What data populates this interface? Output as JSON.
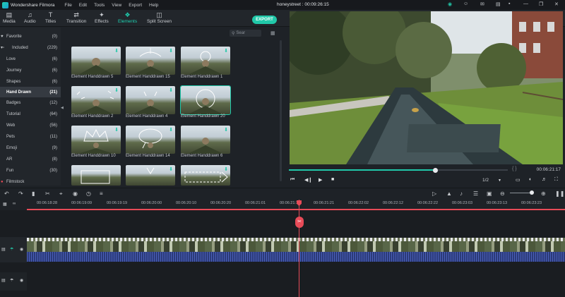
{
  "app": {
    "name": "Wondershare Filmora",
    "project_title": "honeystreet : 00:09:26:15"
  },
  "menu": [
    "File",
    "Edit",
    "Tools",
    "View",
    "Export",
    "Help"
  ],
  "toolbar": {
    "tabs": [
      {
        "label": "Media",
        "icon": "folder-icon"
      },
      {
        "label": "Audio",
        "icon": "music-note-icon"
      },
      {
        "label": "Titles",
        "icon": "text-icon"
      },
      {
        "label": "Transition",
        "icon": "transition-icon"
      },
      {
        "label": "Effects",
        "icon": "effects-icon"
      },
      {
        "label": "Elements",
        "icon": "elements-icon"
      },
      {
        "label": "Split Screen",
        "icon": "split-screen-icon"
      }
    ],
    "active": "Elements",
    "export_label": "EXPORT"
  },
  "sidebar": {
    "items": [
      {
        "label": "Favorite",
        "count": "(0)"
      },
      {
        "label": "Included",
        "count": "(229)"
      },
      {
        "label": "Love",
        "count": "(6)"
      },
      {
        "label": "Journey",
        "count": "(6)"
      },
      {
        "label": "Shapes",
        "count": "(6)"
      },
      {
        "label": "Hand Drawn",
        "count": "(21)"
      },
      {
        "label": "Badges",
        "count": "(12)"
      },
      {
        "label": "Tutorial",
        "count": "(64)"
      },
      {
        "label": "Web",
        "count": "(56)"
      },
      {
        "label": "Pets",
        "count": "(11)"
      },
      {
        "label": "Emoji",
        "count": "(9)"
      },
      {
        "label": "AR",
        "count": "(8)"
      },
      {
        "label": "Fun",
        "count": "(30)"
      },
      {
        "label": "Filmstock",
        "count": ""
      }
    ],
    "selected": "Hand Drawn"
  },
  "library": {
    "search_placeholder": "Sear",
    "items": [
      {
        "label": "Element Handdrawn 5"
      },
      {
        "label": "Element Handdrawn 15"
      },
      {
        "label": "Element Handdrawn 1"
      },
      {
        "label": "Element Handdrawn 2"
      },
      {
        "label": "Element Handdrawn 4"
      },
      {
        "label": "Element Handdrawn 20"
      },
      {
        "label": "Element Handdrawn 10"
      },
      {
        "label": "Element Handdrawn 14"
      },
      {
        "label": "Element Handdrawn 6"
      },
      {
        "label": ""
      },
      {
        "label": ""
      },
      {
        "label": ""
      }
    ],
    "selected": "Element Handdrawn 20"
  },
  "player": {
    "time": "00:06:21:17",
    "progress": 0.67,
    "brackets": "{   }",
    "fraction": "1/2"
  },
  "timeline": {
    "ticks": [
      "00:06:18:28",
      "00:06:19:09",
      "00:06:19:19",
      "00:06:20:00",
      "00:06:20:10",
      "00:06:20:20",
      "00:06:21:01",
      "00:06:21:11",
      "00:06:21:21",
      "00:06:22:02",
      "00:06:22:12",
      "00:06:22:22",
      "00:06:23:03",
      "00:06:23:13",
      "00:06:23:23"
    ]
  },
  "colors": {
    "accent": "#21c8a9",
    "playhead": "#e84b58",
    "audio": "#2b3a78"
  }
}
